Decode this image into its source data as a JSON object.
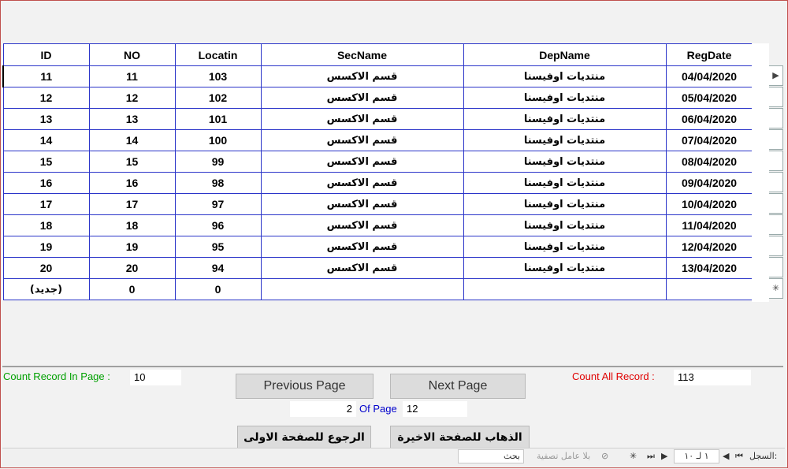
{
  "table": {
    "columns": [
      "ID",
      "NO",
      "Locatin",
      "SecName",
      "DepName",
      "RegDate"
    ],
    "rows": [
      [
        "11",
        "11",
        "103",
        "قسم الاكسس",
        "منتديات اوفيسنا",
        "04/04/2020"
      ],
      [
        "12",
        "12",
        "102",
        "قسم الاكسس",
        "منتديات اوفيسنا",
        "05/04/2020"
      ],
      [
        "13",
        "13",
        "101",
        "قسم الاكسس",
        "منتديات اوفيسنا",
        "06/04/2020"
      ],
      [
        "14",
        "14",
        "100",
        "قسم الاكسس",
        "منتديات اوفيسنا",
        "07/04/2020"
      ],
      [
        "15",
        "15",
        "99",
        "قسم الاكسس",
        "منتديات اوفيسنا",
        "08/04/2020"
      ],
      [
        "16",
        "16",
        "98",
        "قسم الاكسس",
        "منتديات اوفيسنا",
        "09/04/2020"
      ],
      [
        "17",
        "17",
        "97",
        "قسم الاكسس",
        "منتديات اوفيسنا",
        "10/04/2020"
      ],
      [
        "18",
        "18",
        "96",
        "قسم الاكسس",
        "منتديات اوفيسنا",
        "11/04/2020"
      ],
      [
        "19",
        "19",
        "95",
        "قسم الاكسس",
        "منتديات اوفيسنا",
        "12/04/2020"
      ],
      [
        "20",
        "20",
        "94",
        "قسم الاكسس",
        "منتديات اوفيسنا",
        "13/04/2020"
      ]
    ],
    "new_row": [
      "(جديد)",
      "0",
      "0",
      "",
      "",
      ""
    ],
    "current_marker": "▶",
    "new_marker": "✳"
  },
  "footer": {
    "count_in_page_label": "Count Record In Page :",
    "count_in_page_value": "10",
    "count_all_label": "Count All Record :",
    "count_all_value": "113",
    "previous_label": "Previous Page",
    "next_label": "Next Page",
    "current_page": "2",
    "of_page_label": "Of Page",
    "total_pages": "12",
    "first_page_label": "الرجوع للصفحة الاولى",
    "last_page_label": "الذهاب للصفحة الاخيرة"
  },
  "navigator": {
    "record_label": "السجل:",
    "record_value": "١ لـ ١٠",
    "filter_label": "بلا عامل تصفية",
    "search_placeholder": "بحث"
  },
  "colors": {
    "grid_border": "#2b35c9",
    "count_in_page": "#00a000",
    "count_all": "#e00000",
    "of_page": "#0000cc"
  }
}
